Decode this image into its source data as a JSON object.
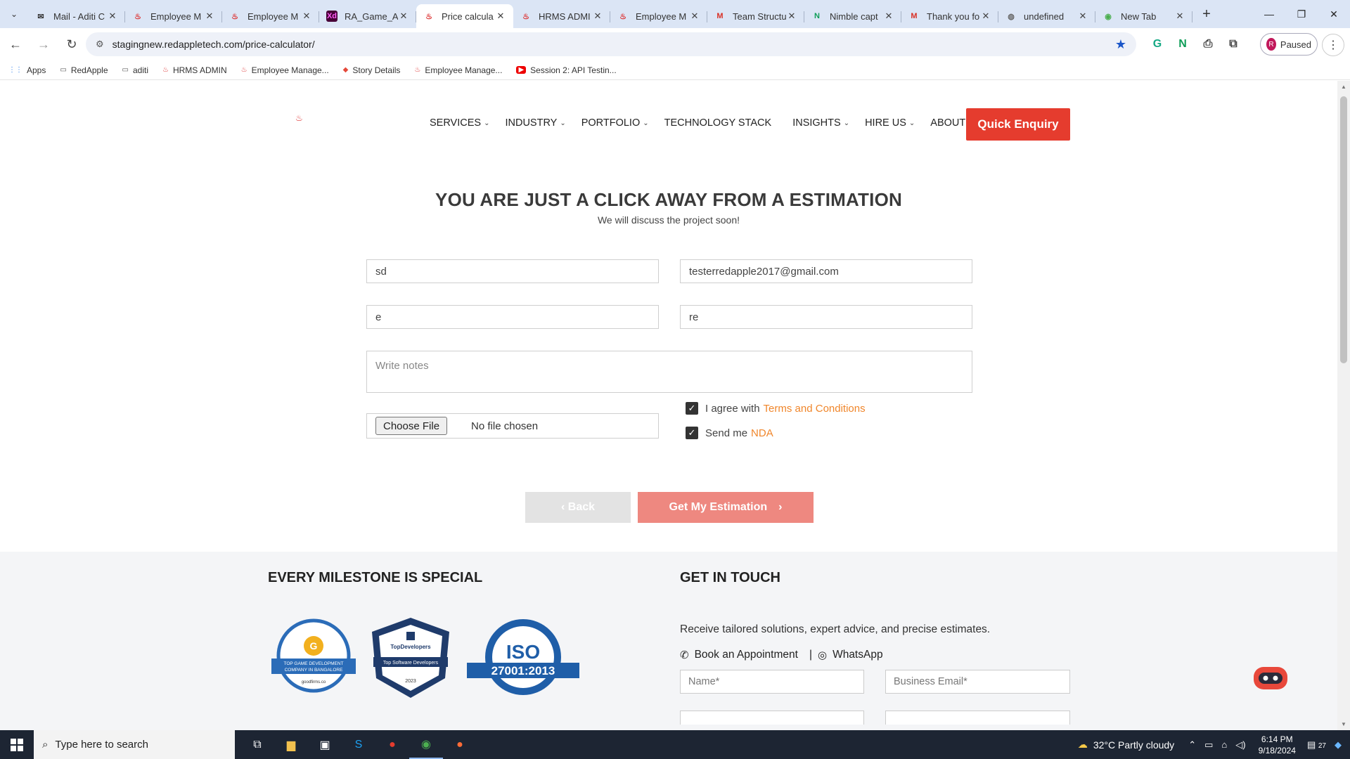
{
  "browser": {
    "tabs": [
      {
        "label": "Mail - Aditi C",
        "icon": "mail-icon",
        "active": false
      },
      {
        "label": "Employee M",
        "icon": "redapple-icon",
        "active": false
      },
      {
        "label": "Employee M",
        "icon": "redapple-icon",
        "active": false
      },
      {
        "label": "RA_Game_Ap",
        "icon": "xd-icon",
        "active": false
      },
      {
        "label": "Price calcula",
        "icon": "redapple-icon",
        "active": true
      },
      {
        "label": "HRMS ADMI",
        "icon": "redapple-icon",
        "active": false
      },
      {
        "label": "Employee M",
        "icon": "redapple-icon",
        "active": false
      },
      {
        "label": "Team Structu",
        "icon": "gmail-icon",
        "active": false
      },
      {
        "label": "Nimble capt",
        "icon": "nimble-icon",
        "active": false
      },
      {
        "label": "Thank you fo",
        "icon": "gmail-icon",
        "active": false
      },
      {
        "label": "undefined",
        "icon": "globe-icon",
        "active": false
      },
      {
        "label": "New Tab",
        "icon": "chrome-icon",
        "active": false
      }
    ],
    "url": "stagingnew.redappletech.com/price-calculator/",
    "profile_label": "Paused",
    "profile_initial": "R",
    "bookmarks": [
      {
        "label": "Apps",
        "icon": "apps-grid-icon"
      },
      {
        "label": "RedApple",
        "icon": "folder-icon"
      },
      {
        "label": "aditi",
        "icon": "folder-icon"
      },
      {
        "label": "HRMS ADMIN",
        "icon": "redapple-icon"
      },
      {
        "label": "Employee Manage...",
        "icon": "redapple-icon"
      },
      {
        "label": "Story Details",
        "icon": "jira-icon"
      },
      {
        "label": "Employee Manage...",
        "icon": "redapple-icon"
      },
      {
        "label": "Session 2: API Testin...",
        "icon": "youtube-icon"
      }
    ]
  },
  "site": {
    "nav": [
      {
        "label": "SERVICES",
        "dropdown": true
      },
      {
        "label": "INDUSTRY",
        "dropdown": true
      },
      {
        "label": "PORTFOLIO",
        "dropdown": true
      },
      {
        "label": "TECHNOLOGY STACK",
        "dropdown": false
      },
      {
        "label": "INSIGHTS",
        "dropdown": true
      },
      {
        "label": "HIRE US",
        "dropdown": true
      },
      {
        "label": "ABOUT US",
        "dropdown": true
      }
    ],
    "quick_enquiry": "Quick Enquiry",
    "accent_color": "#e53c2e",
    "link_color": "#f0862b"
  },
  "form": {
    "title": "YOU ARE JUST A CLICK AWAY FROM A ESTIMATION",
    "subtitle": "We will discuss the project soon!",
    "name_value": "sd",
    "email_value": "testerredapple2017@gmail.com",
    "field3_value": "e",
    "field4_value": "re",
    "notes_placeholder": "Write notes",
    "file_button": "Choose File",
    "file_status": "No file chosen",
    "agree_text": "I agree with",
    "agree_link": "Terms and Conditions",
    "agree_checked": true,
    "nda_text": "Send me",
    "nda_link": "NDA",
    "nda_checked": true,
    "back_label": "Back",
    "estimate_label": "Get My Estimation"
  },
  "footer": {
    "milestone_title": "EVERY MILESTONE IS SPECIAL",
    "badges": [
      {
        "name": "goodfirms-badge",
        "lines": [
          "TOP GAME DEVELOPMENT",
          "COMPANY IN BANGALORE",
          "goodfirms.co"
        ]
      },
      {
        "name": "topdevelopers-badge",
        "lines": [
          "TopDevelopers",
          "Top Software Developers",
          "2023"
        ]
      },
      {
        "name": "iso-badge",
        "lines": [
          "ISO",
          "27001:2013"
        ]
      }
    ],
    "contact_title": "GET IN TOUCH",
    "contact_text": "Receive tailored solutions, expert advice, and precise estimates.",
    "appointment": "Book an Appointment",
    "separator": "|",
    "whatsapp": "WhatsApp",
    "name_placeholder": "Name*",
    "email_placeholder": "Business Email*"
  },
  "taskbar": {
    "search_placeholder": "Type here to search",
    "weather": "32°C  Partly cloudy",
    "time": "6:14 PM",
    "date": "9/18/2024",
    "notification_count": "27"
  }
}
